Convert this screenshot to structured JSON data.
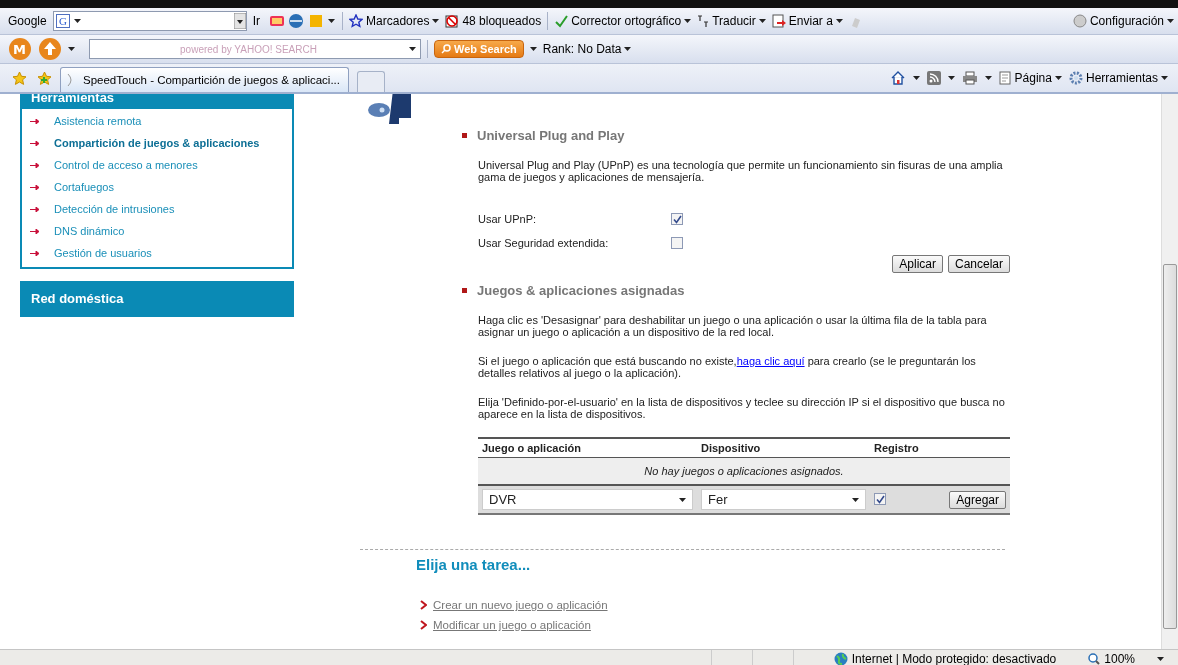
{
  "toolbars": {
    "google": {
      "logo": "Google",
      "g_icon": "G",
      "go": "Ir",
      "bookmarks": "Marcadores",
      "blocked": "48 bloqueados",
      "spellcheck": "Corrector ortográfico",
      "translate": "Traducir",
      "send": "Enviar a",
      "settings": "Configuración"
    },
    "yahoo": {
      "m_button": "M",
      "search_placeholder": "powered by YAHOO! SEARCH",
      "search_button": "Web Search",
      "rank": "Rank: No Data"
    }
  },
  "tabs": [
    {
      "title": "SpeedTouch - Compartición de juegos & aplicaci...",
      "selected": true
    }
  ],
  "command_bar": {
    "page": "Página",
    "tools": "Herramientas"
  },
  "sidebar": {
    "panels": [
      {
        "title": "Herramientas",
        "items": [
          {
            "label": "Asistencia remota",
            "selected": false
          },
          {
            "label": "Compartición de juegos & aplicaciones",
            "selected": true
          },
          {
            "label": "Control de acceso a menores",
            "selected": false
          },
          {
            "label": "Cortafuegos",
            "selected": false
          },
          {
            "label": "Detección de intrusiones",
            "selected": false
          },
          {
            "label": "DNS dinámico",
            "selected": false
          },
          {
            "label": "Gestión de usuarios",
            "selected": false
          }
        ]
      },
      {
        "title": "Red doméstica"
      }
    ]
  },
  "upnp": {
    "title": "Universal Plug and Play",
    "description": "Universal Plug and Play (UPnP) es una tecnología que permite un funcionamiento sin fisuras de una amplia gama de juegos y aplicaciones de mensajería.",
    "options": [
      {
        "label": "Usar UPnP:",
        "checked": true
      },
      {
        "label": "Usar Seguridad extendida:",
        "checked": false
      }
    ],
    "buttons": [
      "Aplicar",
      "Cancelar"
    ]
  },
  "assigned": {
    "title": "Juegos & aplicaciones asignadas",
    "paragraphs": [
      {
        "text": "Haga clic es 'Desasignar' para deshabilitar un juego o una aplicación o usar la última fila de la tabla para asignar un juego o aplicación a un dispositivo de la red local."
      },
      {
        "text": "Si el juego o aplicación que está buscando no existe,",
        "link": "haga clic aquí",
        "after": " para crearlo (se le preguntarán los detalles relativos al juego o la aplicación)."
      },
      {
        "text": "Elija 'Definido-por-el-usuario' en la lista de dispositivos y teclee su dirección IP si el dispositivo que busca no aparece en la lista de dispositivos."
      }
    ],
    "table": {
      "columns": [
        "Juego o aplicación",
        "Dispositivo",
        "Registro"
      ],
      "empty_message": "No hay juegos o aplicaciones asignados.",
      "new_row": {
        "game": "DVR",
        "device": "Fer",
        "registro": true,
        "button": "Agregar"
      }
    }
  },
  "tasks": {
    "title": "Elija una tarea...",
    "links": [
      "Crear un nuevo juego o aplicación",
      "Modificar un juego o aplicación"
    ]
  },
  "status_bar": {
    "zone": "Internet | Modo protegido: desactivado",
    "zoom": "100%"
  }
}
